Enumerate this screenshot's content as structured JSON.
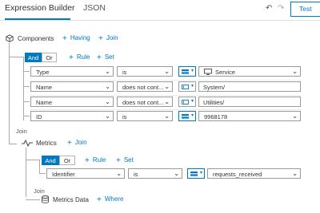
{
  "header": {
    "tab_active": "Expression Builder",
    "tab_json": "JSON",
    "test_label": "Test",
    "undo_icon": "undo-icon",
    "redo_icon": "redo-icon"
  },
  "components": {
    "label": "Components",
    "having": "Having",
    "join": "Join",
    "and": "And",
    "or": "Or",
    "rule": "Rule",
    "set": "Set",
    "rows": [
      {
        "field": "Type",
        "op": "is",
        "value": "Service",
        "value_icon": "monitor-icon"
      },
      {
        "field": "Name",
        "op": "does not cont...",
        "value": "System/"
      },
      {
        "field": "Name",
        "op": "does not cont...",
        "value": "Utilities/"
      },
      {
        "field": "ID",
        "op": "is",
        "value": "9968178"
      }
    ]
  },
  "metrics": {
    "join_label": "Join",
    "label": "Metrics",
    "join": "Join",
    "and": "And",
    "or": "Or",
    "rule": "Rule",
    "set": "Set",
    "rows": [
      {
        "field": "Identifier",
        "op": "is",
        "value": "requests_received"
      }
    ]
  },
  "metrics_data": {
    "join_label": "Join",
    "label": "Metrics Data",
    "where": "Where"
  },
  "colors": {
    "accent": "#0079c1",
    "border": "#9a9a9a"
  }
}
